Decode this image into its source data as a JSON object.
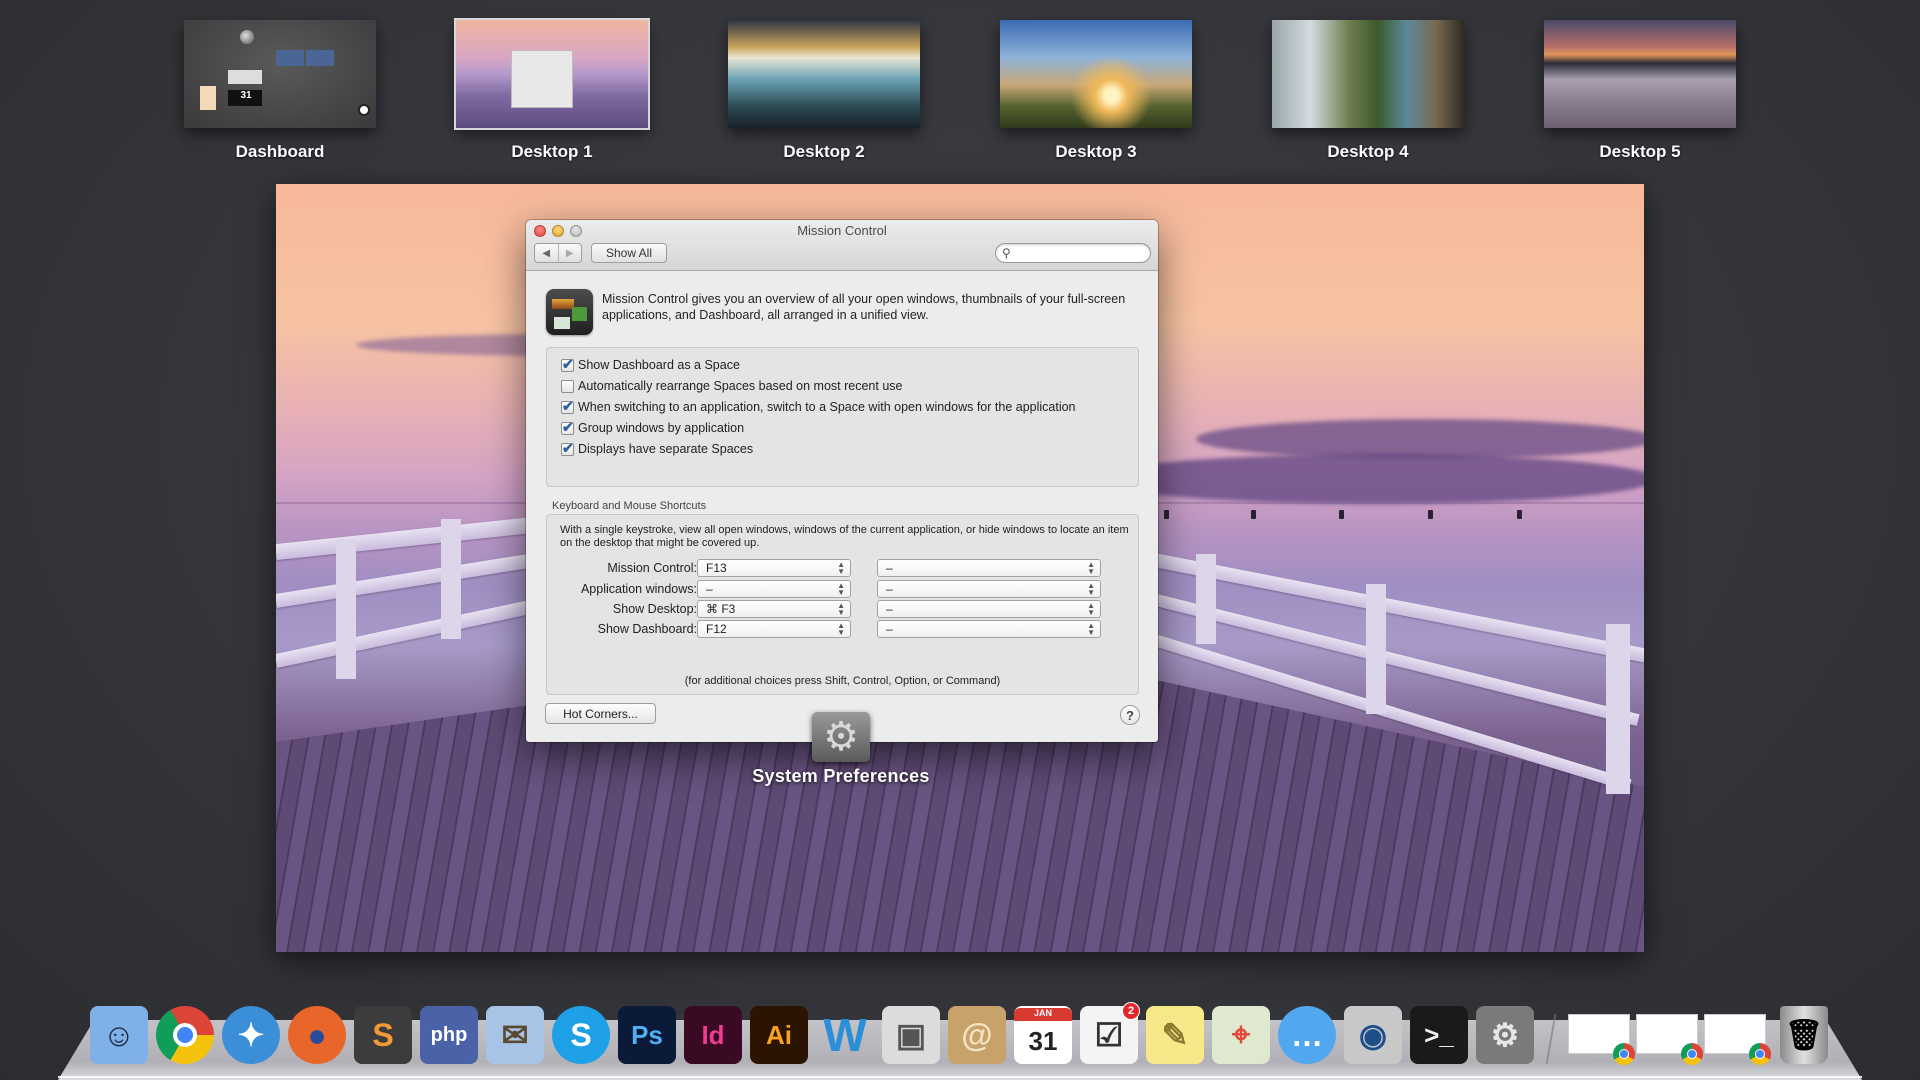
{
  "spaces": [
    {
      "label": "Dashboard",
      "active": false
    },
    {
      "label": "Desktop 1",
      "active": true
    },
    {
      "label": "Desktop 2",
      "active": false
    },
    {
      "label": "Desktop 3",
      "active": false
    },
    {
      "label": "Desktop 4",
      "active": false
    },
    {
      "label": "Desktop 5",
      "active": false
    }
  ],
  "window": {
    "title": "Mission Control",
    "nav_back": "◀",
    "nav_forward": "▶",
    "show_all": "Show All",
    "search_placeholder": "",
    "search_icon": "⚲",
    "intro": "Mission Control gives you an overview of all your open windows, thumbnails of your full-screen applications, and Dashboard, all arranged in a unified view.",
    "options": [
      {
        "label": "Show Dashboard as a Space",
        "checked": true
      },
      {
        "label": "Automatically rearrange Spaces based on most recent use",
        "checked": false
      },
      {
        "label": "When switching to an application, switch to a Space with open windows for the application",
        "checked": true
      },
      {
        "label": "Group windows by application",
        "checked": true
      },
      {
        "label": "Displays have separate Spaces",
        "checked": true
      }
    ],
    "shortcuts_title": "Keyboard and Mouse Shortcuts",
    "shortcuts_desc": "With a single keystroke, view all open windows, windows of the current application, or hide windows to locate an item on the desktop that might be covered up.",
    "shortcuts": [
      {
        "label": "Mission Control:",
        "key": "F13",
        "mouse": "–"
      },
      {
        "label": "Application windows:",
        "key": "–",
        "mouse": "–"
      },
      {
        "label": "Show Desktop:",
        "key": "⌘ F3",
        "mouse": "–"
      },
      {
        "label": "Show Dashboard:",
        "key": "F12",
        "mouse": "–"
      }
    ],
    "hint": "(for additional choices press Shift, Control, Option, or Command)",
    "hot_corners": "Hot Corners...",
    "help": "?"
  },
  "app_label": "System Preferences",
  "app_icon": "⚙",
  "dock": {
    "apps": [
      {
        "name": "finder",
        "glyph": "☺",
        "bg": "#7fb0e8",
        "fg": "#1d2a44"
      },
      {
        "name": "chrome",
        "glyph": "",
        "bg": "chrome",
        "fg": "#fff"
      },
      {
        "name": "safari",
        "glyph": "✦",
        "bg": "#3b8fd9",
        "fg": "#fff"
      },
      {
        "name": "firefox",
        "glyph": "●",
        "bg": "#e8662a",
        "fg": "#2a4a9a"
      },
      {
        "name": "sublime-text",
        "glyph": "S",
        "bg": "#3c3c3c",
        "fg": "#f29a38"
      },
      {
        "name": "phpstorm",
        "glyph": "php",
        "bg": "#4a62a8",
        "fg": "#fff"
      },
      {
        "name": "mail",
        "glyph": "✉",
        "bg": "#a7c4e6",
        "fg": "#5a4a30"
      },
      {
        "name": "skype",
        "glyph": "S",
        "bg": "#1ea0e6",
        "fg": "#fff"
      },
      {
        "name": "photoshop",
        "glyph": "Ps",
        "bg": "#0c1a3a",
        "fg": "#4fb0f6"
      },
      {
        "name": "indesign",
        "glyph": "Id",
        "bg": "#3a0a24",
        "fg": "#ee3d8f"
      },
      {
        "name": "illustrator",
        "glyph": "Ai",
        "bg": "#2b1402",
        "fg": "#f7a21c"
      },
      {
        "name": "word",
        "glyph": "W",
        "bg": "transparent",
        "fg": "#2a8ed8"
      },
      {
        "name": "preview",
        "glyph": "▣",
        "bg": "#dcdcdc",
        "fg": "#555"
      },
      {
        "name": "contacts",
        "glyph": "@",
        "bg": "#c8a26a",
        "fg": "#f3e3c3"
      },
      {
        "name": "calendar",
        "glyph": "31",
        "bg": "#ffffff",
        "fg": "#222",
        "sub": "JAN"
      },
      {
        "name": "reminders",
        "glyph": "☑",
        "bg": "#f4f4f4",
        "fg": "#333",
        "badge": "2"
      },
      {
        "name": "notes",
        "glyph": "✎",
        "bg": "#f7e98a",
        "fg": "#8a7a30"
      },
      {
        "name": "maps",
        "glyph": "⌖",
        "bg": "#dfe9d0",
        "fg": "#e24a3a"
      },
      {
        "name": "messages",
        "glyph": "…",
        "bg": "#52a8f0",
        "fg": "#fff"
      },
      {
        "name": "facetime",
        "glyph": "◉",
        "bg": "#c8c8c8",
        "fg": "#1d4f8a"
      },
      {
        "name": "terminal",
        "glyph": ">_",
        "bg": "#1a1a1a",
        "fg": "#eee"
      },
      {
        "name": "system-preferences",
        "glyph": "⚙",
        "bg": "#7a7a7a",
        "fg": "#e6e6e6"
      }
    ],
    "minimized": [
      {
        "name": "chrome-window-1"
      },
      {
        "name": "chrome-window-2"
      },
      {
        "name": "chrome-window-3"
      }
    ],
    "trash": {
      "name": "trash",
      "glyph": "🗑"
    }
  }
}
